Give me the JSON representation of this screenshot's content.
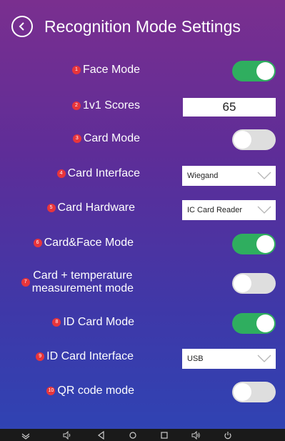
{
  "header": {
    "title": "Recognition Mode Settings"
  },
  "settings": {
    "face_mode": {
      "num": "1",
      "label": "Face Mode",
      "enabled": true
    },
    "scores": {
      "num": "2",
      "label": "1v1 Scores",
      "value": "65"
    },
    "card_mode": {
      "num": "3",
      "label": "Card Mode",
      "enabled": false
    },
    "card_interface": {
      "num": "4",
      "label": "Card Interface",
      "selected": "Wiegand"
    },
    "card_hardware": {
      "num": "5",
      "label": "Card Hardware",
      "selected": "IC Card Reader"
    },
    "card_face_mode": {
      "num": "6",
      "label": "Card&Face Mode",
      "enabled": true
    },
    "card_temp_mode": {
      "num": "7",
      "label_line1": "Card + temperature",
      "label_line2": "measurement mode",
      "enabled": false
    },
    "id_card_mode": {
      "num": "8",
      "label": "ID Card Mode",
      "enabled": true
    },
    "id_card_interface": {
      "num": "9",
      "label": "ID Card Interface",
      "selected": "USB"
    },
    "qr_code_mode": {
      "num": "10",
      "label": "QR code mode",
      "enabled": false
    }
  },
  "colors": {
    "toggle_on": "#2fae5f",
    "toggle_off": "#dedede",
    "badge": "#e8353b"
  },
  "icons": [
    "back-arrow-icon",
    "chevron-down-icon",
    "hide-keyboard-icon",
    "volume-down-icon",
    "nav-back-icon",
    "nav-home-icon",
    "nav-recents-icon",
    "volume-up-icon",
    "power-icon"
  ]
}
